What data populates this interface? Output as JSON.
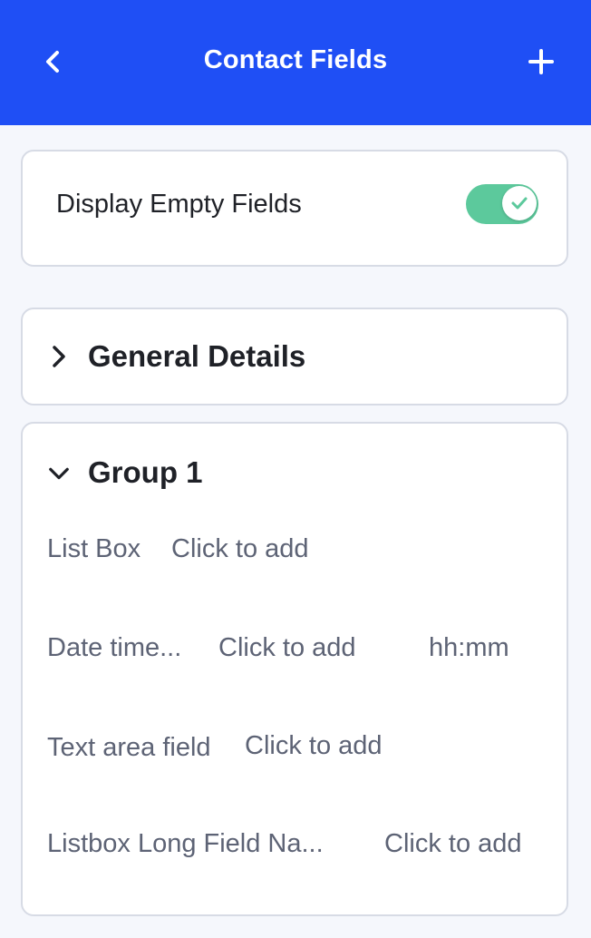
{
  "header": {
    "title": "Contact Fields",
    "back_icon": "chevron-left-icon",
    "add_icon": "plus-icon",
    "background_color": "#1f4ff5"
  },
  "display_empty": {
    "label": "Display Empty Fields",
    "enabled": true,
    "toggle_color": "#5cc99c"
  },
  "sections": [
    {
      "title": "General Details",
      "expanded": false
    },
    {
      "title": "Group 1",
      "expanded": true
    }
  ],
  "group1": {
    "fields": [
      {
        "label": "List Box",
        "value": "Click to add"
      },
      {
        "label": "Date time...",
        "value": "Click to add",
        "extra": "hh:mm"
      },
      {
        "label": "Text area field",
        "value": "Click to add"
      },
      {
        "label": "Listbox Long Field Na...",
        "value": "Click to add"
      }
    ]
  }
}
